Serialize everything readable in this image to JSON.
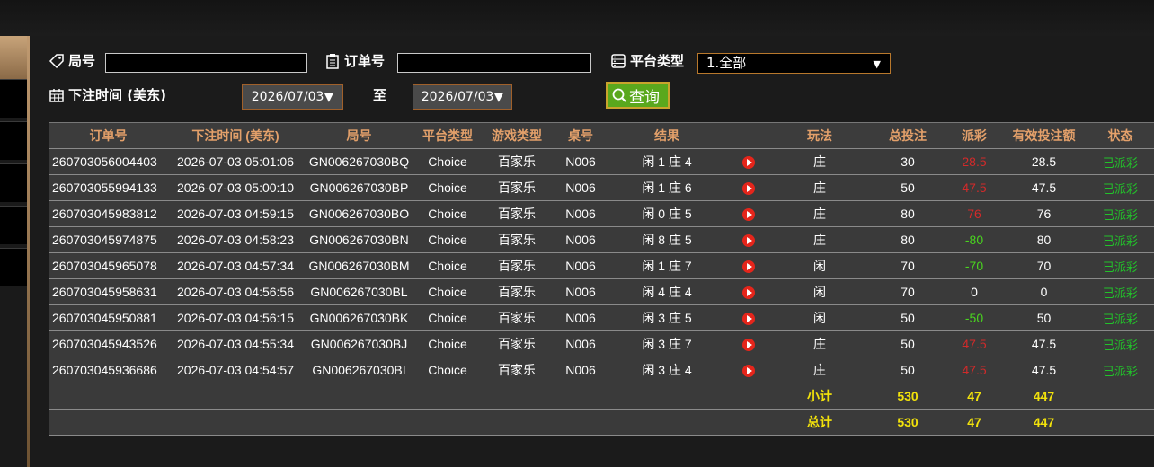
{
  "filters": {
    "round_label": "局号",
    "round_value": "",
    "order_label": "订单号",
    "order_value": "",
    "platform_label": "平台类型",
    "platform_selected": "1.全部",
    "time_label": "下注时间 (美东)",
    "date_from": "2026/07/03▼",
    "to_label": "至",
    "date_to": "2026/07/03▼",
    "query_label": "查询"
  },
  "table": {
    "headers": [
      "订单号",
      "下注时间 (美东)",
      "局号",
      "平台类型",
      "游戏类型",
      "桌号",
      "结果",
      "",
      "玩法",
      "总投注",
      "派彩",
      "有效投注额",
      "状态"
    ],
    "rows": [
      {
        "order": "260703056004403",
        "time": "2026-07-03 05:01:06",
        "round": "GN006267030BQ",
        "platform": "Choice",
        "game": "百家乐",
        "table": "N006",
        "result": "闲 1 庄 4",
        "play": "庄",
        "bet": "30",
        "payout": "28.5",
        "payout_color": "red",
        "valid": "28.5",
        "status": "已派彩"
      },
      {
        "order": "260703055994133",
        "time": "2026-07-03 05:00:10",
        "round": "GN006267030BP",
        "platform": "Choice",
        "game": "百家乐",
        "table": "N006",
        "result": "闲 1 庄 6",
        "play": "庄",
        "bet": "50",
        "payout": "47.5",
        "payout_color": "red",
        "valid": "47.5",
        "status": "已派彩"
      },
      {
        "order": "260703045983812",
        "time": "2026-07-03 04:59:15",
        "round": "GN006267030BO",
        "platform": "Choice",
        "game": "百家乐",
        "table": "N006",
        "result": "闲 0 庄 5",
        "play": "庄",
        "bet": "80",
        "payout": "76",
        "payout_color": "red",
        "valid": "76",
        "status": "已派彩"
      },
      {
        "order": "260703045974875",
        "time": "2026-07-03 04:58:23",
        "round": "GN006267030BN",
        "platform": "Choice",
        "game": "百家乐",
        "table": "N006",
        "result": "闲 8 庄 5",
        "play": "庄",
        "bet": "80",
        "payout": "-80",
        "payout_color": "green",
        "valid": "80",
        "status": "已派彩"
      },
      {
        "order": "260703045965078",
        "time": "2026-07-03 04:57:34",
        "round": "GN006267030BM",
        "platform": "Choice",
        "game": "百家乐",
        "table": "N006",
        "result": "闲 1 庄 7",
        "play": "闲",
        "bet": "70",
        "payout": "-70",
        "payout_color": "green",
        "valid": "70",
        "status": "已派彩"
      },
      {
        "order": "260703045958631",
        "time": "2026-07-03 04:56:56",
        "round": "GN006267030BL",
        "platform": "Choice",
        "game": "百家乐",
        "table": "N006",
        "result": "闲 4 庄 4",
        "play": "闲",
        "bet": "70",
        "payout": "0",
        "payout_color": "white",
        "valid": "0",
        "status": "已派彩"
      },
      {
        "order": "260703045950881",
        "time": "2026-07-03 04:56:15",
        "round": "GN006267030BK",
        "platform": "Choice",
        "game": "百家乐",
        "table": "N006",
        "result": "闲 3 庄 5",
        "play": "闲",
        "bet": "50",
        "payout": "-50",
        "payout_color": "green",
        "valid": "50",
        "status": "已派彩"
      },
      {
        "order": "260703045943526",
        "time": "2026-07-03 04:55:34",
        "round": "GN006267030BJ",
        "platform": "Choice",
        "game": "百家乐",
        "table": "N006",
        "result": "闲 3 庄 7",
        "play": "庄",
        "bet": "50",
        "payout": "47.5",
        "payout_color": "red",
        "valid": "47.5",
        "status": "已派彩"
      },
      {
        "order": "260703045936686",
        "time": "2026-07-03 04:54:57",
        "round": "GN006267030BI",
        "platform": "Choice",
        "game": "百家乐",
        "table": "N006",
        "result": "闲 3 庄 4",
        "play": "庄",
        "bet": "50",
        "payout": "47.5",
        "payout_color": "red",
        "valid": "47.5",
        "status": "已派彩"
      }
    ],
    "subtotal": {
      "label": "小计",
      "bet": "530",
      "payout": "47",
      "valid": "447"
    },
    "total": {
      "label": "总计",
      "bet": "530",
      "payout": "47",
      "valid": "447"
    }
  },
  "colors": {
    "header_text": "#e3a06a",
    "summary_text": "#f2e20b",
    "payout_win": "#d22a2a",
    "payout_loss": "#49d41f",
    "status_text": "#22c22a",
    "query_button": "#5aa81d"
  },
  "icons": [
    "tag-icon",
    "clipboard-icon",
    "server-icon",
    "calendar-icon",
    "search-icon",
    "play-icon"
  ]
}
